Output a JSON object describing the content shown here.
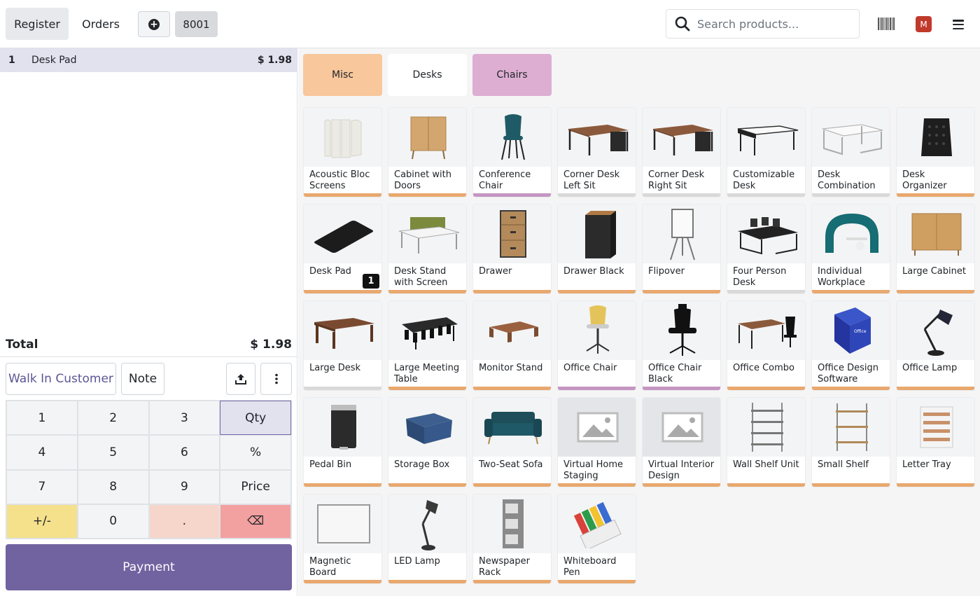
{
  "topbar": {
    "register_label": "Register",
    "orders_label": "Orders",
    "new_order_icon": "plus-circle-icon",
    "order_number": "8001",
    "search_placeholder": "Search products...",
    "user_initial": "M"
  },
  "order": {
    "lines": [
      {
        "qty": "1",
        "name": "Desk Pad",
        "price": "$ 1.98"
      }
    ],
    "total_label": "Total",
    "total_value": "$ 1.98"
  },
  "actions": {
    "customer_label": "Walk In Customer",
    "note_label": "Note"
  },
  "numpad": {
    "keys": [
      "1",
      "2",
      "3",
      "Qty",
      "4",
      "5",
      "6",
      "%",
      "7",
      "8",
      "9",
      "Price",
      "+/-",
      "0",
      ".",
      "⌫"
    ]
  },
  "payment_label": "Payment",
  "categories": [
    {
      "label": "Misc",
      "color": "#f8c79b"
    },
    {
      "label": "Desks",
      "color": "#ffffff"
    },
    {
      "label": "Chairs",
      "color": "#ddaed2"
    }
  ],
  "colors": {
    "misc": "#e9a86e",
    "chairs": "#c596c2",
    "neutral": "#d9d9d9",
    "accent": "#7162a0"
  },
  "products": [
    {
      "name": "Acoustic Bloc Screens",
      "icon": "acoustic-screen-icon",
      "category": "misc"
    },
    {
      "name": "Cabinet with Doors",
      "icon": "cabinet-icon",
      "category": "misc"
    },
    {
      "name": "Conference Chair",
      "icon": "chair-icon",
      "category": "chairs"
    },
    {
      "name": "Corner Desk Left Sit",
      "icon": "desk-icon",
      "category": "neutral"
    },
    {
      "name": "Corner Desk Right Sit",
      "icon": "desk-icon",
      "category": "neutral"
    },
    {
      "name": "Customizable Desk",
      "icon": "desk-icon",
      "category": "neutral"
    },
    {
      "name": "Desk Combination",
      "icon": "desk-icon",
      "category": "neutral"
    },
    {
      "name": "Desk Organizer",
      "icon": "organizer-icon",
      "category": "misc"
    },
    {
      "name": "Desk Pad",
      "icon": "desk-pad-icon",
      "category": "misc",
      "qty": "1"
    },
    {
      "name": "Desk Stand with Screen",
      "icon": "desk-icon",
      "category": "misc"
    },
    {
      "name": "Drawer",
      "icon": "drawer-icon",
      "category": "misc"
    },
    {
      "name": "Drawer Black",
      "icon": "drawer-icon",
      "category": "misc"
    },
    {
      "name": "Flipover",
      "icon": "flipchart-icon",
      "category": "misc"
    },
    {
      "name": "Four Person Desk",
      "icon": "desk-icon",
      "category": "neutral"
    },
    {
      "name": "Individual Workplace",
      "icon": "workplace-icon",
      "category": "misc"
    },
    {
      "name": "Large Cabinet",
      "icon": "cabinet-icon",
      "category": "misc"
    },
    {
      "name": "Large Desk",
      "icon": "desk-icon",
      "category": "neutral"
    },
    {
      "name": "Large Meeting Table",
      "icon": "table-icon",
      "category": "misc"
    },
    {
      "name": "Monitor Stand",
      "icon": "monitor-stand-icon",
      "category": "misc"
    },
    {
      "name": "Office Chair",
      "icon": "chair-icon",
      "category": "chairs"
    },
    {
      "name": "Office Chair Black",
      "icon": "chair-icon",
      "category": "chairs"
    },
    {
      "name": "Office Combo",
      "icon": "desk-icon",
      "category": "misc"
    },
    {
      "name": "Office Design Software",
      "icon": "software-box-icon",
      "category": "misc"
    },
    {
      "name": "Office Lamp",
      "icon": "lamp-icon",
      "category": "misc"
    },
    {
      "name": "Pedal Bin",
      "icon": "bin-icon",
      "category": "misc"
    },
    {
      "name": "Storage Box",
      "icon": "box-icon",
      "category": "misc"
    },
    {
      "name": "Two-Seat Sofa",
      "icon": "sofa-icon",
      "category": "misc"
    },
    {
      "name": "Virtual Home Staging",
      "icon": "image-placeholder-icon",
      "category": "misc"
    },
    {
      "name": "Virtual Interior Design",
      "icon": "image-placeholder-icon",
      "category": "misc"
    },
    {
      "name": "Wall Shelf Unit",
      "icon": "shelf-icon",
      "category": "misc"
    },
    {
      "name": "Small Shelf",
      "icon": "shelf-icon",
      "category": "misc"
    },
    {
      "name": "Letter Tray",
      "icon": "tray-icon",
      "category": "misc"
    },
    {
      "name": "Magnetic Board",
      "icon": "whiteboard-icon",
      "category": "misc"
    },
    {
      "name": "LED Lamp",
      "icon": "lamp-icon",
      "category": "misc"
    },
    {
      "name": "Newspaper Rack",
      "icon": "rack-icon",
      "category": "misc"
    },
    {
      "name": "Whiteboard Pen",
      "icon": "pen-icon",
      "category": "misc"
    }
  ]
}
